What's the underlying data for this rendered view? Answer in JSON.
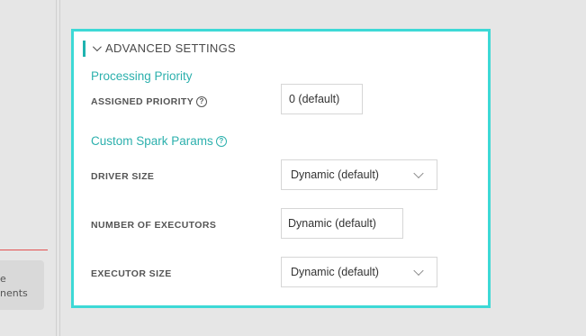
{
  "left_card": {
    "line1": "e",
    "line2": "nents"
  },
  "panel": {
    "header_title": "ADVANCED SETTINGS",
    "processing_priority": {
      "title": "Processing Priority",
      "assigned_priority_label": "ASSIGNED PRIORITY",
      "assigned_priority_value": "0 (default)"
    },
    "custom_spark": {
      "title": "Custom Spark Params",
      "driver_size_label": "DRIVER SIZE",
      "driver_size_value": "Dynamic (default)",
      "num_executors_label": "NUMBER OF EXECUTORS",
      "num_executors_value": "Dynamic (default)",
      "executor_size_label": "EXECUTOR SIZE",
      "executor_size_value": "Dynamic (default)"
    }
  },
  "icons": {
    "help": "?"
  },
  "colors": {
    "panel_border": "#3dd9d6",
    "accent": "#2cb0ad",
    "divider_red": "#e35252"
  }
}
